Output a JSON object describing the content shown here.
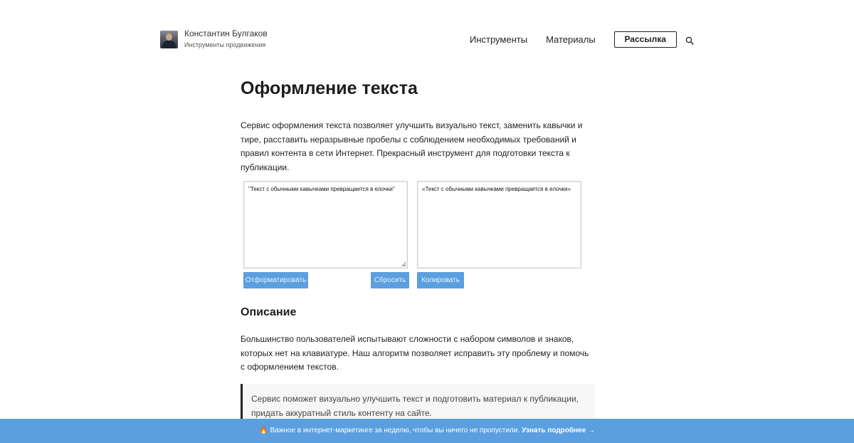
{
  "header": {
    "author_name": "Константин Булгаков",
    "tagline": "Инструменты продвижения",
    "nav": {
      "tools": "Инструменты",
      "materials": "Материалы",
      "newsletter": "Рассылка"
    },
    "search_icon": "search-icon"
  },
  "main": {
    "title": "Оформление текста",
    "intro": "Сервис оформления текста позволяет улучшить визуально текст, заменить кавычки и тире, расставить неразрывные пробелы с соблюдением необходимых требований и правил контента в сети Интернет. Прекрасный инструмент для подготовки текста к публикации.",
    "tool": {
      "input_value": "\"Текст с обычными кавычками превращается в елочки\"",
      "output_value": "«Текст с обычными кавычками превращается в елочки»",
      "format_label": "Отформатировать",
      "reset_label": "Сбросить",
      "copy_label": "Копировать"
    },
    "description_heading": "Описание",
    "description": "Большинство пользователей испытывают сложности с набором символов и знаков, которых нет на клавиатуре. Наш алгоритм позволяет исправить эту проблему и помочь с оформлением текстов.",
    "quote": "Сервис поможет визуально улучшить текст и подготовить материал к публикации, придать аккуратный стиль контенту на сайте."
  },
  "banner": {
    "icon": "🔥",
    "text": "Важное в интернет-маркетинге за неделю, чтобы вы ничего не пропустили.",
    "link": "Узнать подробнее →"
  },
  "colors": {
    "accent": "#5b9fe0",
    "text": "#222222",
    "quote_bg": "#f6f6f6"
  }
}
